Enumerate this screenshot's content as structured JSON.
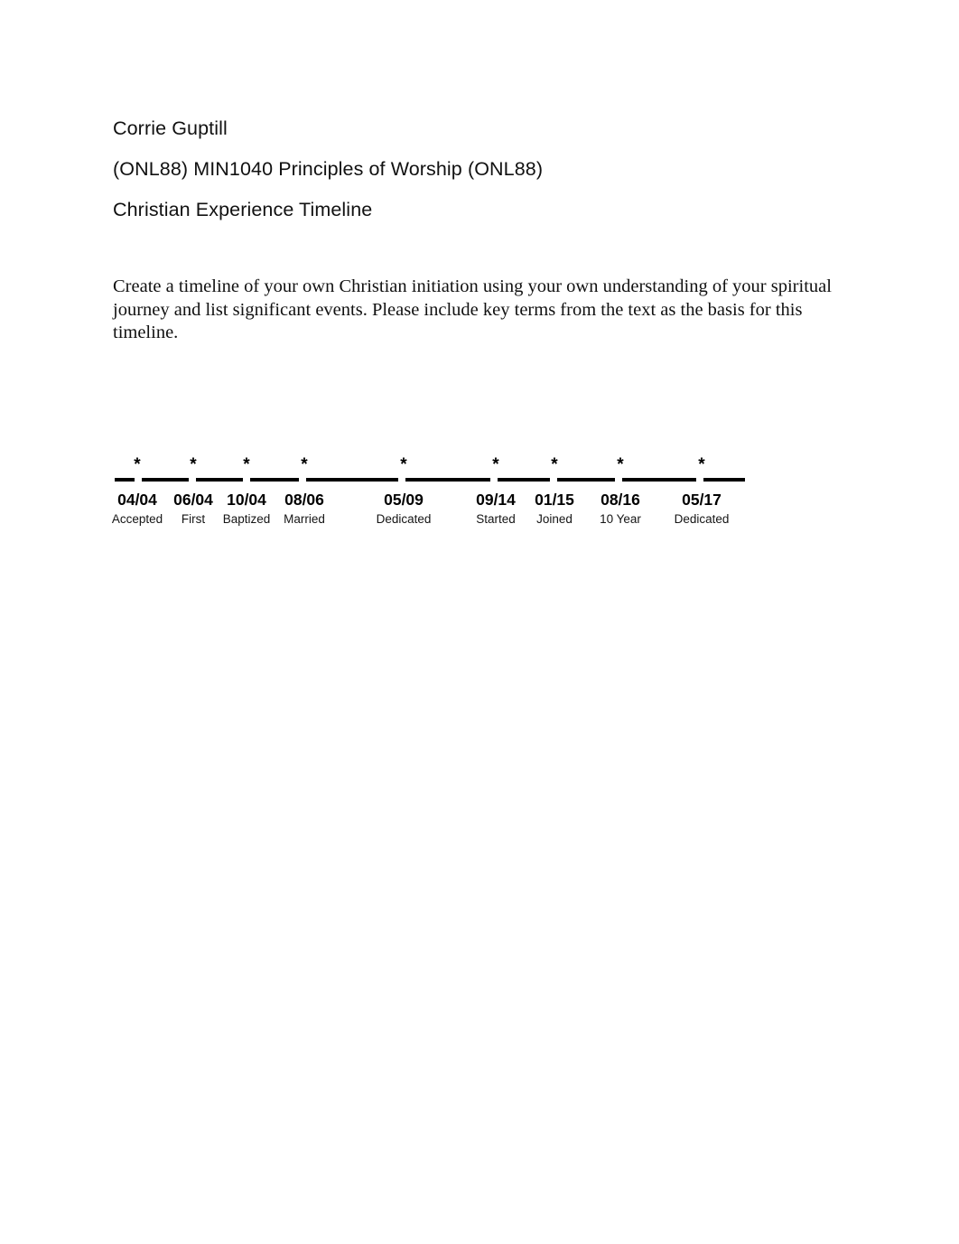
{
  "document": {
    "author": "Corrie Guptill",
    "course": "(ONL88) MIN1040 Principles of Worship (ONL88)",
    "assignment_title": "Christian Experience Timeline"
  },
  "instructions": {
    "text": "Create a timeline of your own Christian initiation using your own understanding of your spiritual journey and list significant events. Please include key terms from the text as the basis for this timeline."
  },
  "timeline": {
    "marker_glyph": "*",
    "entries": [
      {
        "date": "04/04",
        "label": "Accepted",
        "note": ""
      },
      {
        "date": "06/04",
        "label": "First",
        "note": ""
      },
      {
        "date": "10/04",
        "label": "Baptized",
        "note": ""
      },
      {
        "date": "08/06",
        "label": "Married",
        "note": ""
      },
      {
        "date": "05/09",
        "label": "Dedicated",
        "note": ""
      },
      {
        "date": "09/14",
        "label": "Started",
        "note": ""
      },
      {
        "date": "01/15",
        "label": "Joined",
        "note": ""
      },
      {
        "date": "08/16",
        "label": "10 Year",
        "note": ""
      },
      {
        "date": "05/17",
        "label": "Dedicated",
        "note": ""
      }
    ]
  },
  "body": {
    "quote_paragraph": "",
    "closing_paragraph": ""
  }
}
